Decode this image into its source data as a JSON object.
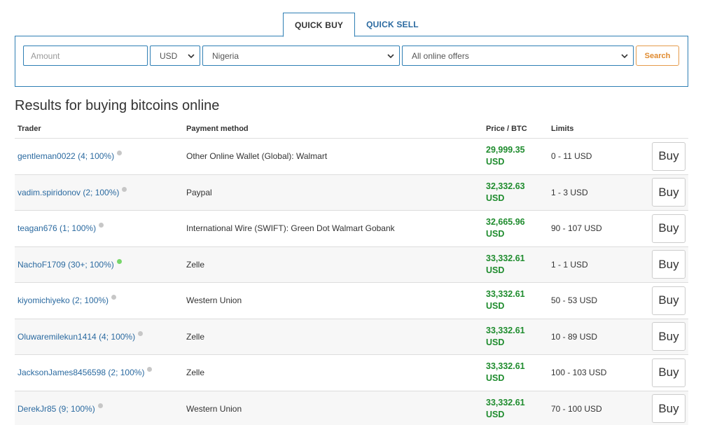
{
  "tabs": {
    "quick_buy": "QUICK BUY",
    "quick_sell": "QUICK SELL"
  },
  "search": {
    "amount_placeholder": "Amount",
    "currency": "USD",
    "country": "Nigeria",
    "offers": "All online offers",
    "button": "Search"
  },
  "results": {
    "title": "Results for buying bitcoins online",
    "headers": {
      "trader": "Trader",
      "payment": "Payment method",
      "price": "Price / BTC",
      "limits": "Limits"
    },
    "rows": [
      {
        "trader": "gentleman0022 (4; 100%)",
        "online": false,
        "payment": "Other Online Wallet (Global): Walmart",
        "price": "29,999.35",
        "currency": "USD",
        "limits": "0 - 11 USD",
        "button": "Buy"
      },
      {
        "trader": "vadim.spiridonov (2; 100%)",
        "online": false,
        "payment": "Paypal",
        "price": "32,332.63",
        "currency": "USD",
        "limits": "1 - 3 USD",
        "button": "Buy"
      },
      {
        "trader": "teagan676 (1; 100%)",
        "online": false,
        "payment": "International Wire (SWIFT): Green Dot Walmart Gobank",
        "price": "32,665.96",
        "currency": "USD",
        "limits": "90 - 107 USD",
        "button": "Buy"
      },
      {
        "trader": "NachoF1709 (30+; 100%)",
        "online": true,
        "payment": "Zelle",
        "price": "33,332.61",
        "currency": "USD",
        "limits": "1 - 1 USD",
        "button": "Buy"
      },
      {
        "trader": "kiyomichiyeko (2; 100%)",
        "online": false,
        "payment": "Western Union",
        "price": "33,332.61",
        "currency": "USD",
        "limits": "50 - 53 USD",
        "button": "Buy"
      },
      {
        "trader": "Oluwaremilekun1414 (4; 100%)",
        "online": false,
        "payment": "Zelle",
        "price": "33,332.61",
        "currency": "USD",
        "limits": "10 - 89 USD",
        "button": "Buy"
      },
      {
        "trader": "JacksonJames8456598 (2; 100%)",
        "online": false,
        "payment": "Zelle",
        "price": "33,332.61",
        "currency": "USD",
        "limits": "100 - 103 USD",
        "button": "Buy"
      },
      {
        "trader": "DerekJr85 (9; 100%)",
        "online": false,
        "payment": "Western Union",
        "price": "33,332.61",
        "currency": "USD",
        "limits": "70 - 100 USD",
        "button": "Buy"
      }
    ]
  },
  "colors": {
    "accent": "#2f7fb4",
    "link": "#2b6aa0",
    "price": "#1f8c2e",
    "search_button": "#e08a2e",
    "online_dot": "#77d66a",
    "offline_dot": "#c7c7c7"
  }
}
